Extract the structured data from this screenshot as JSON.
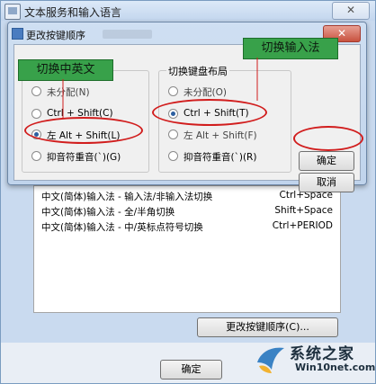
{
  "main_window": {
    "title": "文本服务和输入语言",
    "close_label": "✕"
  },
  "dialog": {
    "title": "更改按键顺序",
    "close_label": "✕",
    "groups": {
      "language": {
        "label": "",
        "options": [
          {
            "label": "未分配(N)",
            "checked": false
          },
          {
            "label": "Ctrl + Shift(C)",
            "checked": false
          },
          {
            "label": "左 Alt + Shift(L)",
            "checked": true
          },
          {
            "label": "抑音符重音(`)(G)",
            "checked": false
          }
        ]
      },
      "layout": {
        "label": "切换键盘布局",
        "options": [
          {
            "label": "未分配(O)",
            "checked": false
          },
          {
            "label": "Ctrl + Shift(T)",
            "checked": true
          },
          {
            "label": "左 Alt + Shift(F)",
            "checked": false
          },
          {
            "label": "抑音符重音(`)(R)",
            "checked": false
          }
        ]
      }
    },
    "ok_label": "确定",
    "cancel_label": "取消"
  },
  "callouts": {
    "switch_cn_en": "切换中英文",
    "switch_ime": "切换输入法"
  },
  "hotkeys": [
    {
      "name": "中文(简体)输入法 - 输入法/非输入法切换",
      "keys": "Ctrl+Space"
    },
    {
      "name": "中文(简体)输入法 - 全/半角切换",
      "keys": "Shift+Space"
    },
    {
      "name": "中文(简体)输入法 - 中/英标点符号切换",
      "keys": "Ctrl+PERIOD"
    }
  ],
  "buttons": {
    "change_sequence": "更改按键顺序(C)...",
    "ok": "确定"
  },
  "watermark": {
    "name": "系统之家",
    "url": "Win10net.com"
  },
  "colors": {
    "callout_green": "#38a14a",
    "highlight_red": "#d11d1d"
  }
}
